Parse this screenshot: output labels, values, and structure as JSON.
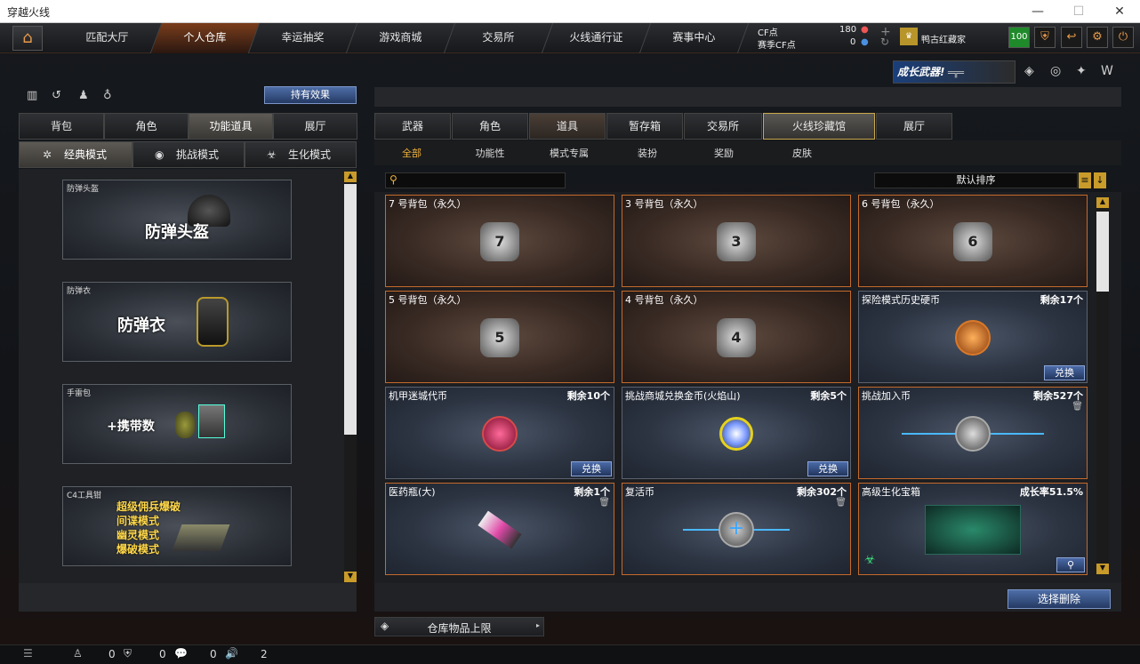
{
  "window": {
    "title": "穿越火线"
  },
  "topnav": {
    "tabs": [
      "匹配大厅",
      "个人仓库",
      "幸运抽奖",
      "游戏商城",
      "交易所",
      "火线通行证",
      "赛事中心"
    ],
    "active": 1,
    "cf_label": "CF点",
    "cf_value": "180",
    "sjcf_label": "赛季CF点",
    "sjcf_value": "0",
    "clan": "鸭古红藏家",
    "level": "100"
  },
  "banner": {
    "text": "成长武器!"
  },
  "left": {
    "hold_effect": "持有效果",
    "tabs": [
      "背包",
      "角色",
      "功能道具",
      "展厅"
    ],
    "active_tab": 2,
    "modes": [
      "经典模式",
      "挑战模式",
      "生化模式"
    ],
    "active_mode": 0,
    "cards": [
      {
        "label": "防弹头盔",
        "title": "防弹头盔"
      },
      {
        "label": "防弹衣",
        "title": "防弹衣"
      },
      {
        "label": "手雷包",
        "title": "+携带数"
      },
      {
        "label": "C4工具钳",
        "lines": [
          "超级佣兵爆破",
          "间谍模式",
          "幽灵模式",
          "爆破模式"
        ]
      }
    ]
  },
  "right": {
    "tabs": [
      "武器",
      "角色",
      "道具",
      "暂存箱",
      "交易所",
      "火线珍藏馆",
      "展厅"
    ],
    "active_tab": 5,
    "subtabs": [
      "全部",
      "功能性",
      "模式专属",
      "装扮",
      "奖励",
      "皮肤"
    ],
    "active_sub": 0,
    "sort": "默认排序",
    "delete_btn": "选择删除",
    "capacity": "仓库物品上限",
    "items": [
      {
        "name": "7 号背包（永久）",
        "bag": "7",
        "style": "bag"
      },
      {
        "name": "3 号背包（永久）",
        "bag": "3",
        "style": "bag"
      },
      {
        "name": "6 号背包（永久）",
        "bag": "6",
        "style": "bag"
      },
      {
        "name": "5 号背包（永久）",
        "bag": "5",
        "style": "bag"
      },
      {
        "name": "4 号背包（永久）",
        "bag": "4",
        "style": "bag"
      },
      {
        "name": "探险模式历史硬币",
        "remain": "剩余17个",
        "button": "兑换",
        "style": "coin-orange"
      },
      {
        "name": "机甲迷城代币",
        "remain": "剩余10个",
        "button": "兑换",
        "style": "coin-red"
      },
      {
        "name": "挑战商城兑换金币(火焰山)",
        "remain": "剩余5个",
        "button": "兑换",
        "style": "coin-gold"
      },
      {
        "name": "挑战加入币",
        "remain": "剩余527个",
        "style": "coin-silver"
      },
      {
        "name": "医药瓶(大)",
        "remain": "剩余1个",
        "style": "medic"
      },
      {
        "name": "复活币",
        "remain": "剩余302个",
        "style": "revive"
      },
      {
        "name": "高级生化宝箱",
        "remain": "成长率51.5%",
        "style": "box"
      }
    ]
  },
  "status": {
    "v1": "0",
    "v2": "0",
    "v3": "0",
    "v4": "2"
  }
}
